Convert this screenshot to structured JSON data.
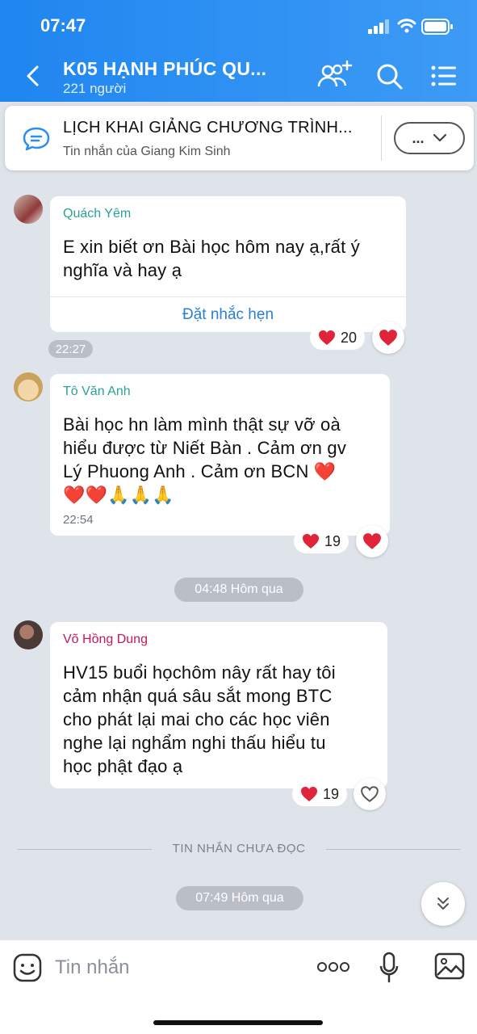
{
  "status_bar": {
    "time": "07:47"
  },
  "header": {
    "title": "K05 HẠNH PHÚC QU...",
    "member_count": "221 người",
    "accent": "#2a8ef2"
  },
  "pinned": {
    "title": "LỊCH KHAI GIẢNG CHƯƠNG TRÌNH...",
    "subtitle": "Tin nhắn của Giang Kim Sinh",
    "more_label": "..."
  },
  "messages": [
    {
      "sender": "Quách Yêm",
      "sender_color": "#2aa198",
      "text_lines": [
        "E xin biết ơn Bài học hôm nay ạ,rất ý",
        "nghĩa và hay ạ"
      ],
      "action": "Đặt nhắc hẹn",
      "time": "22:27",
      "reaction_count": "20"
    },
    {
      "sender": "Tô Văn Anh",
      "sender_color": "#2aa198",
      "text_lines": [
        "Bài học hn làm mình thật sự vỡ oà",
        "hiểu được từ Niết Bàn . Cảm ơn gv",
        "Lý Phuong  Anh . Cảm ơn BCN ❤️",
        "❤️❤️🙏🙏🙏"
      ],
      "time": "22:54",
      "reaction_count": "19"
    },
    {
      "sender": "Võ Hồng Dung",
      "sender_color": "#c2185b",
      "text_lines": [
        "HV15 buổi họchôm nây rất hay tôi",
        "cảm nhận quá sâu sắt mong BTC",
        "cho phát lại mai cho các học viên",
        "nghe lại nghẩm nghi thấu hiểu tu",
        "học phật đạo ạ"
      ],
      "reaction_count": "19"
    }
  ],
  "separators": {
    "day1": "04:48 Hôm qua",
    "unread": "TIN NHẮN CHƯA ĐỌC",
    "day2": "07:49 Hôm qua"
  },
  "composer": {
    "placeholder": "Tin nhắn"
  },
  "icons": {
    "back": "chevron-left-icon",
    "add_member": "add-user-icon",
    "search": "search-icon",
    "menu": "list-menu-icon",
    "pin": "chat-bubble-icon",
    "sticker": "sticker-icon",
    "more": "more-dots-icon",
    "mic": "microphone-icon",
    "image": "image-icon",
    "scroll": "double-chevron-down-icon",
    "heart": "heart-icon"
  },
  "colors": {
    "heart": "#e0243a",
    "link": "#2a7fd4",
    "background": "#dfe3ea"
  }
}
